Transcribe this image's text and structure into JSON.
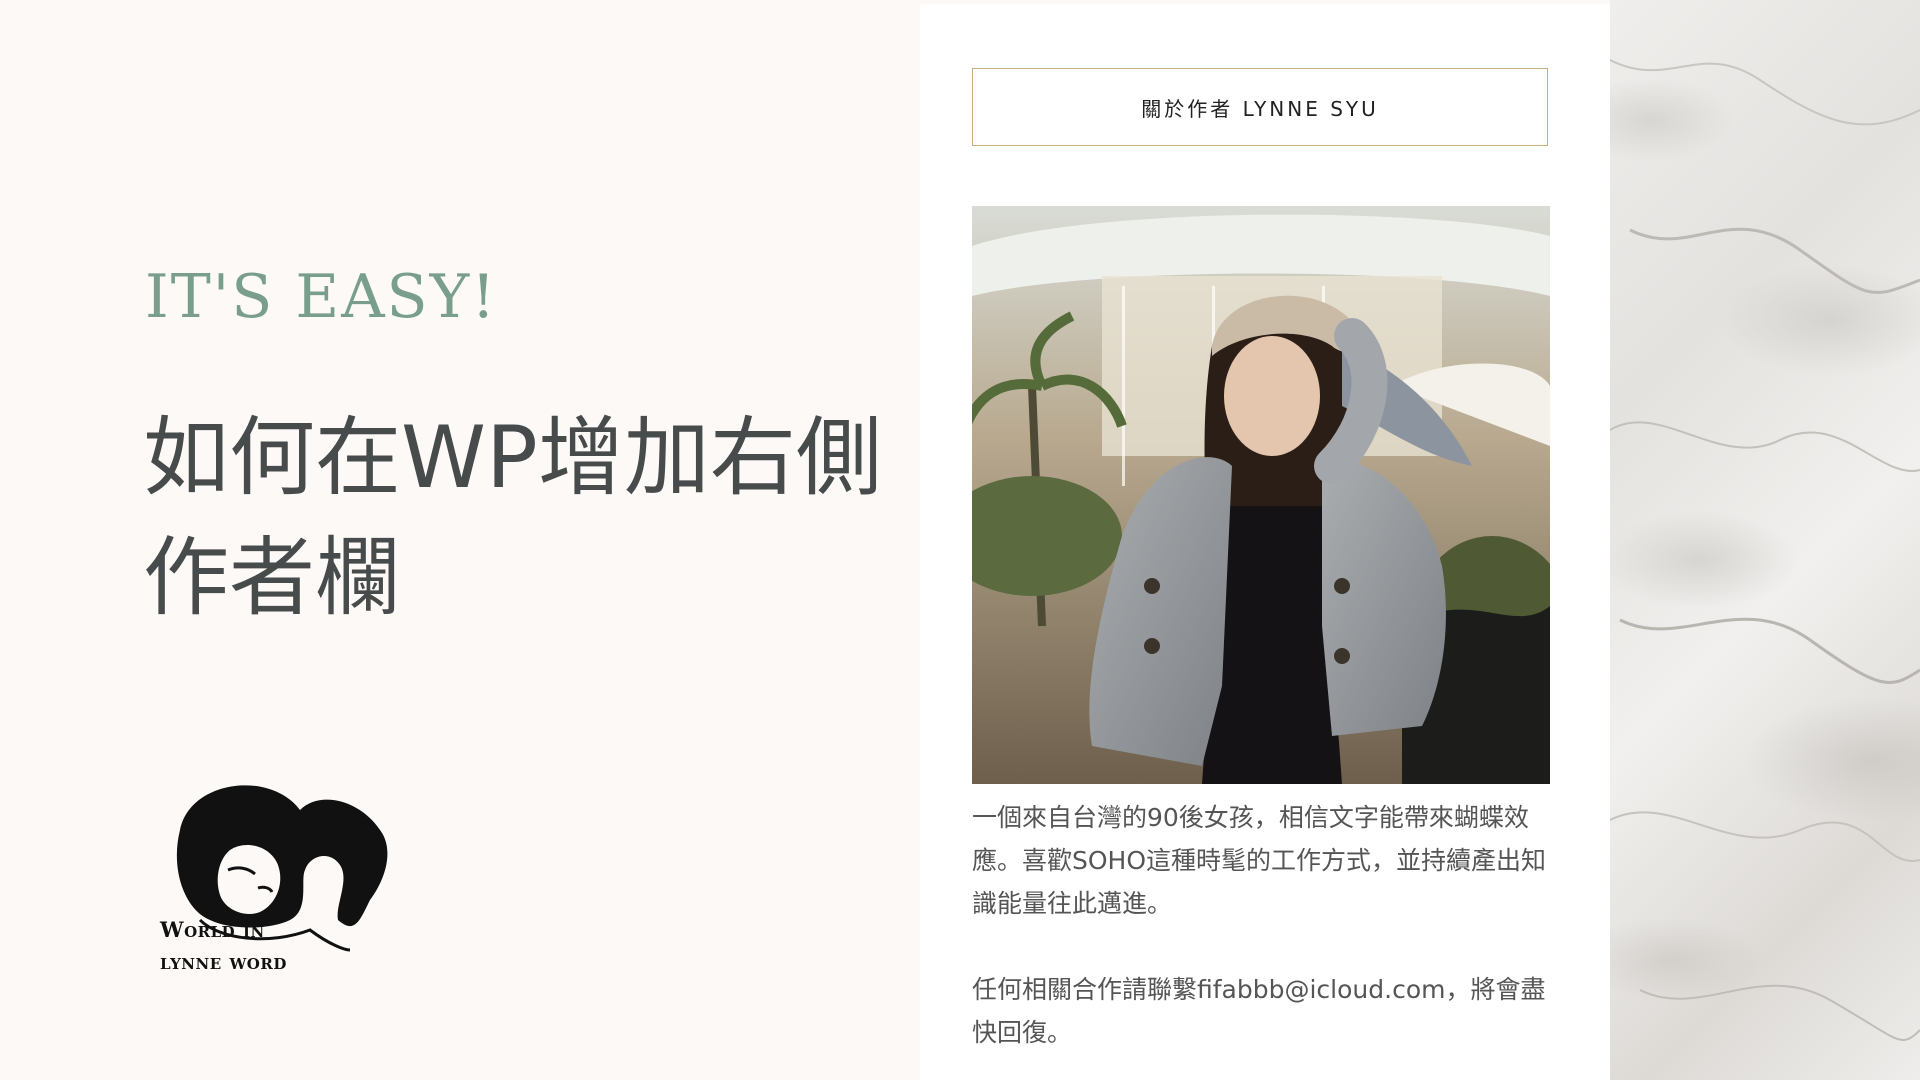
{
  "left": {
    "tagline": "IT'S EASY!",
    "headline_line1": "如何在WP增加右側",
    "headline_line2": "作者欄",
    "logo": {
      "icon": "woman-portrait-logo-icon",
      "line1": "World in",
      "line2": "lynne word"
    }
  },
  "card": {
    "header": "關於作者 LYNNE SYU",
    "photo": "author-photo",
    "bio_paragraph1": "一個來自台灣的90後女孩，相信文字能帶來蝴蝶效應。喜歡SOHO這種時髦的工作方式，並持續產出知識能量往此邁進。",
    "bio_paragraph2": "任何相關合作請聯繫fifabbb@icloud.com，將會盡快回復。"
  },
  "colors": {
    "background": "#fcf9f6",
    "tagline": "#7a9e8c",
    "headline": "#474b4c",
    "header_border": "#c8ad7f",
    "body_text": "#555555"
  }
}
